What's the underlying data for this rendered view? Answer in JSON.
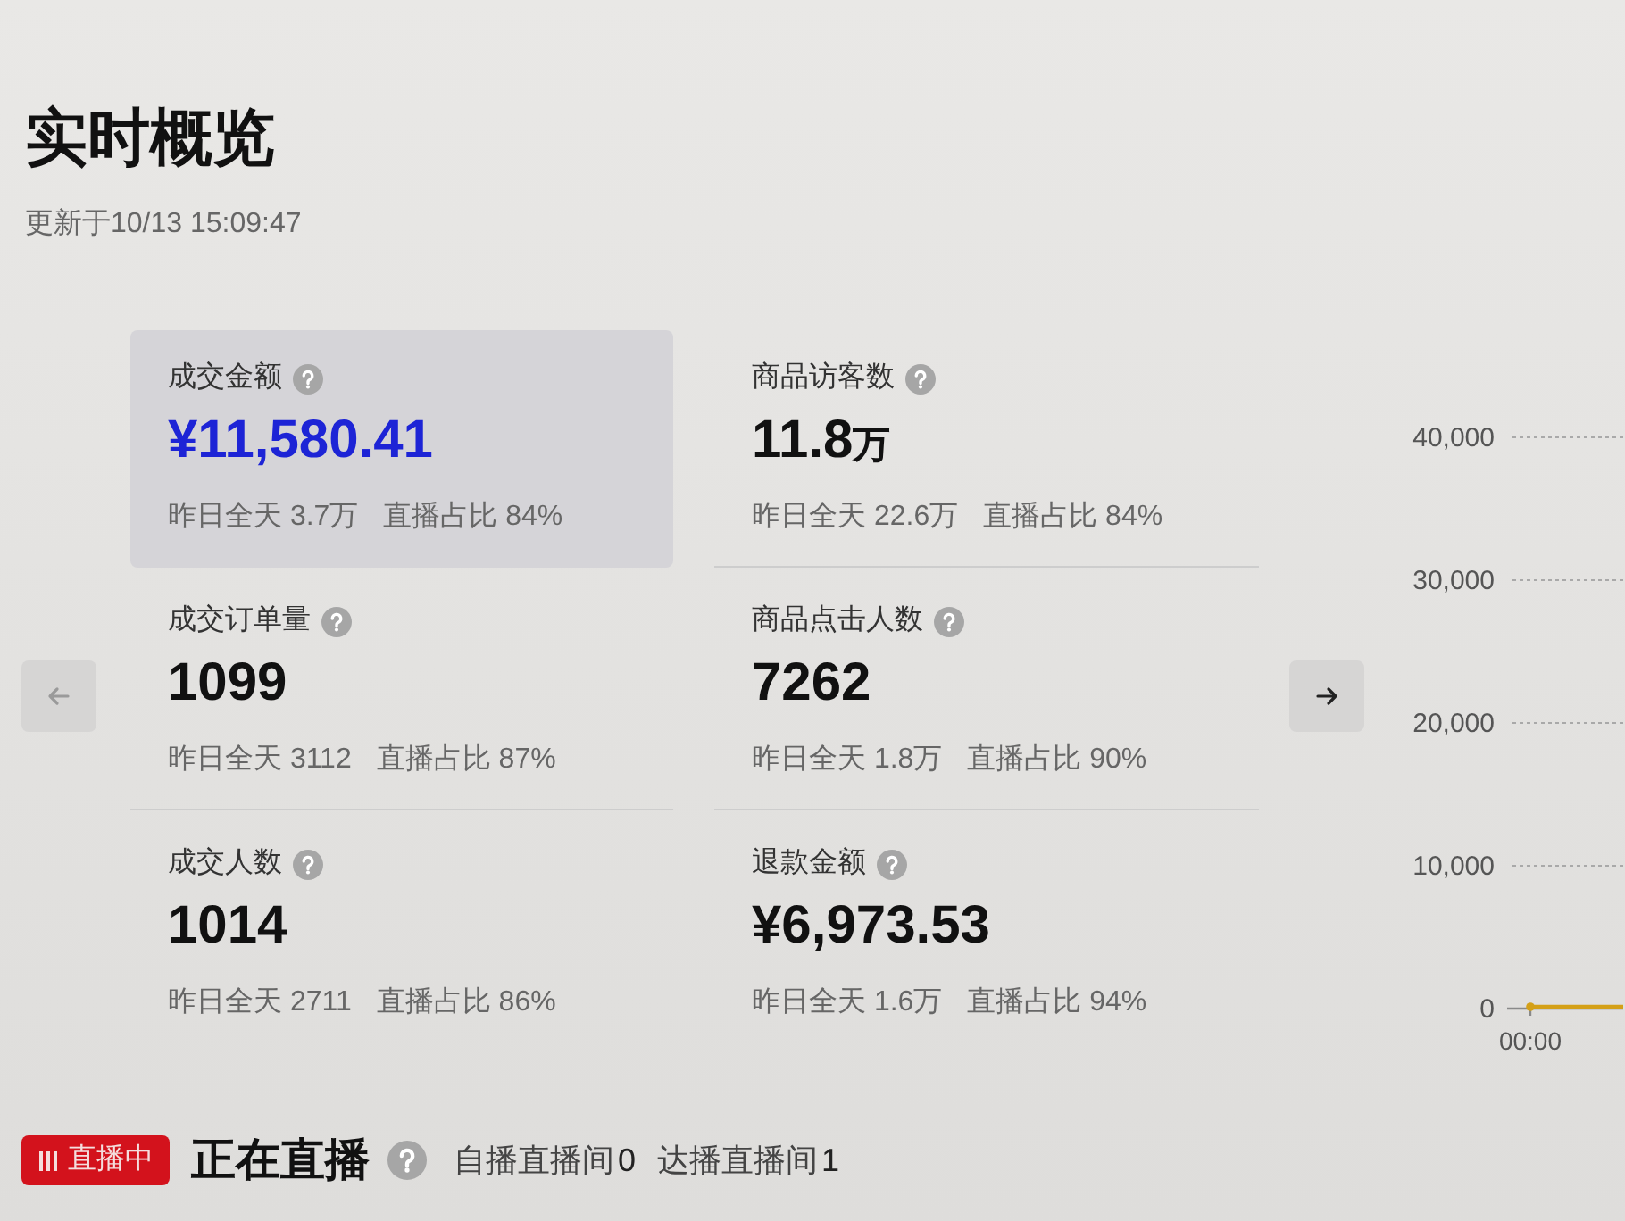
{
  "header": {
    "title": "实时概览",
    "updated": "更新于10/13 15:09:47"
  },
  "pager": [
    {
      "kind": "previous",
      "disabled": true
    },
    {
      "kind": "next",
      "disabled": false
    }
  ],
  "metrics": [
    {
      "label": "成交金额",
      "value": "¥11,580.41",
      "yesterday": "昨日全天 3.7万",
      "live_share": "直播占比 84%",
      "selected": true
    },
    {
      "label": "商品访客数",
      "value": "11.8",
      "unit": "万",
      "yesterday": "昨日全天 22.6万",
      "live_share": "直播占比 84%",
      "selected": false
    },
    {
      "label": "成交订单量",
      "value": "1099",
      "yesterday": "昨日全天 3112",
      "live_share": "直播占比 87%",
      "selected": false
    },
    {
      "label": "商品点击人数",
      "value": "7262",
      "yesterday": "昨日全天 1.8万",
      "live_share": "直播占比 90%",
      "selected": false
    },
    {
      "label": "成交人数",
      "value": "1014",
      "yesterday": "昨日全天 2711",
      "live_share": "直播占比 86%",
      "selected": false
    },
    {
      "label": "退款金额",
      "value": "¥6,973.53",
      "yesterday": "昨日全天 1.6万",
      "live_share": "直播占比 94%",
      "selected": false
    }
  ],
  "trend": {
    "chart_data": {
      "type": "line",
      "categories": [
        "00:00"
      ],
      "ylim": [
        0,
        40000
      ],
      "yticks": [
        {
          "value": 0,
          "label": "0"
        },
        {
          "value": 10000,
          "label": "10,000"
        },
        {
          "value": 20000,
          "label": "20,000"
        },
        {
          "value": 30000,
          "label": "30,000"
        },
        {
          "value": 40000,
          "label": "40,000"
        }
      ],
      "grid": true,
      "series": [
        {
          "color": "#d4a017",
          "marker": "circle",
          "values": [
            0
          ]
        }
      ]
    }
  },
  "live_bar": {
    "badge": "直播中",
    "title": "正在直播",
    "rooms": [
      {
        "label": "自播直播间",
        "count": "0"
      },
      {
        "label": "达播直播间",
        "count": "1"
      }
    ]
  }
}
